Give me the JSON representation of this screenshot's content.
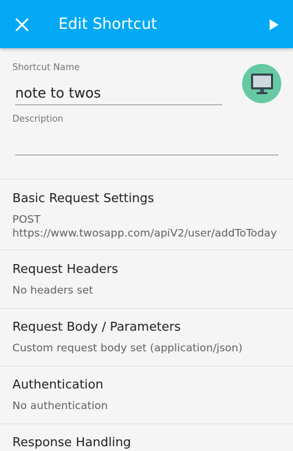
{
  "app_bar": {
    "title": "Edit Shortcut",
    "background": "#03a9f4",
    "close_icon": "close-icon",
    "run_icon": "play-icon"
  },
  "form": {
    "name_label": "Shortcut Name",
    "name_value": "note to twos",
    "description_label": "Description",
    "description_value": "",
    "avatar_icon": "monitor-icon",
    "avatar_color": "#67c9a3"
  },
  "sections": [
    {
      "title": "Basic Request Settings",
      "subtitle": "POST https://www.twosapp.com/apiV2/user/addToToday"
    },
    {
      "title": "Request Headers",
      "subtitle": "No headers set"
    },
    {
      "title": "Request Body / Parameters",
      "subtitle": "Custom request body set (application/json)"
    },
    {
      "title": "Authentication",
      "subtitle": "No authentication"
    },
    {
      "title": "Response Handling",
      "subtitle": ""
    }
  ]
}
